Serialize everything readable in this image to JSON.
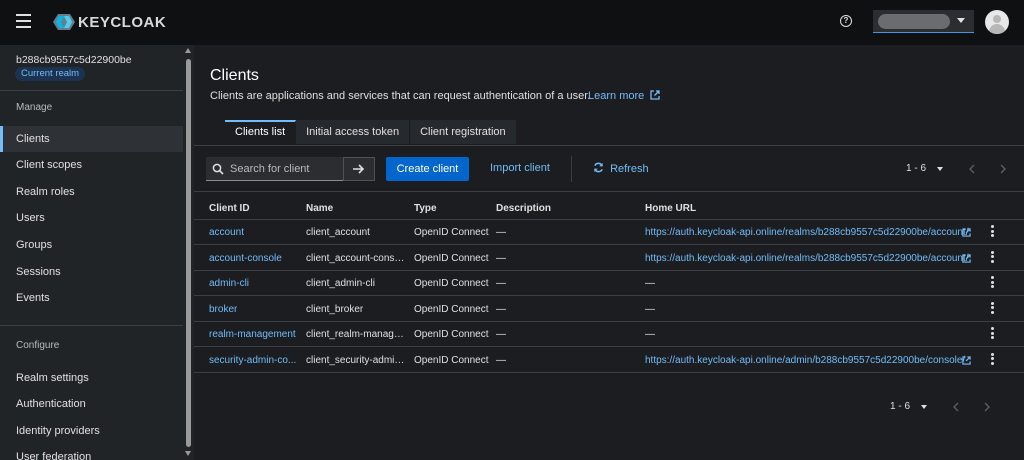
{
  "header": {
    "brand": "KEYCLOAK"
  },
  "sidebar": {
    "realm_id": "b288cb9557c5d22900be",
    "realm_badge": "Current realm",
    "manage_label": "Manage",
    "manage_items": [
      {
        "label": "Clients",
        "active": true
      },
      {
        "label": "Client scopes",
        "active": false
      },
      {
        "label": "Realm roles",
        "active": false
      },
      {
        "label": "Users",
        "active": false
      },
      {
        "label": "Groups",
        "active": false
      },
      {
        "label": "Sessions",
        "active": false
      },
      {
        "label": "Events",
        "active": false
      }
    ],
    "configure_label": "Configure",
    "configure_items": [
      {
        "label": "Realm settings"
      },
      {
        "label": "Authentication"
      },
      {
        "label": "Identity providers"
      },
      {
        "label": "User federation"
      }
    ]
  },
  "main": {
    "title": "Clients",
    "description": "Clients are applications and services that can request authentication of a user.",
    "learn_more": "Learn more",
    "tabs": [
      {
        "label": "Clients list",
        "active": true
      },
      {
        "label": "Initial access token",
        "active": false
      },
      {
        "label": "Client registration",
        "active": false
      }
    ],
    "toolbar": {
      "search_placeholder": "Search for client",
      "create_label": "Create client",
      "import_label": "Import client",
      "refresh_label": "Refresh"
    },
    "pagination": {
      "range": "1 - 6"
    },
    "columns": [
      "Client ID",
      "Name",
      "Type",
      "Description",
      "Home URL"
    ],
    "rows": [
      {
        "client_id": "account",
        "name": "client_account",
        "type": "OpenID Connect",
        "description": "—",
        "home_url": "https://auth.keycloak-api.online/realms/b288cb9557c5d22900be/account/",
        "has_link": true
      },
      {
        "client_id": "account-console",
        "name": "client_account-conso...",
        "type": "OpenID Connect",
        "description": "—",
        "home_url": "https://auth.keycloak-api.online/realms/b288cb9557c5d22900be/account/",
        "has_link": true
      },
      {
        "client_id": "admin-cli",
        "name": "client_admin-cli",
        "type": "OpenID Connect",
        "description": "—",
        "home_url": "—",
        "has_link": false
      },
      {
        "client_id": "broker",
        "name": "client_broker",
        "type": "OpenID Connect",
        "description": "—",
        "home_url": "—",
        "has_link": false
      },
      {
        "client_id": "realm-management",
        "name": "client_realm-manage...",
        "type": "OpenID Connect",
        "description": "—",
        "home_url": "—",
        "has_link": false
      },
      {
        "client_id": "security-admin-co...",
        "name": "client_security-admin...",
        "type": "OpenID Connect",
        "description": "—",
        "home_url": "https://auth.keycloak-api.online/admin/b288cb9557c5d22900be/console/",
        "has_link": true
      }
    ]
  },
  "colors": {
    "accent": "#73bcf7",
    "primary_button": "#0066cc",
    "header_bg": "#0f1012",
    "sidebar_bg": "#212427",
    "main_bg": "#1b1d21"
  }
}
